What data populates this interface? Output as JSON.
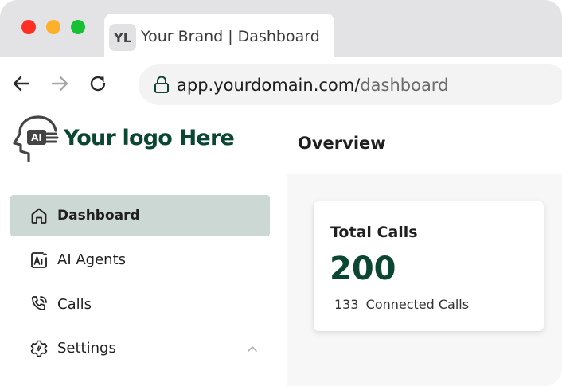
{
  "browser": {
    "window_controls": [
      "close",
      "minimize",
      "zoom"
    ],
    "tab": {
      "favicon_text": "YL",
      "title": "Your Brand | Dashboard"
    },
    "address_bar": {
      "host": "app.yourdomain.com/",
      "path": "dashboard",
      "lock_icon": "lock-icon"
    },
    "nav_icons": [
      "back-arrow-icon",
      "forward-arrow-icon",
      "reload-icon"
    ]
  },
  "sidebar": {
    "logo": {
      "icon_text": "AI",
      "text": "Your logo Here"
    },
    "items": [
      {
        "label": "Dashboard",
        "icon": "home-icon",
        "active": true
      },
      {
        "label": "AI Agents",
        "icon": "ai-agent-icon",
        "active": false
      },
      {
        "label": "Calls",
        "icon": "phone-call-icon",
        "active": false
      },
      {
        "label": "Settings",
        "icon": "gear-icon",
        "active": false,
        "expanded": true
      }
    ]
  },
  "main": {
    "title": "Overview",
    "cards": [
      {
        "title": "Total Calls",
        "value": "200",
        "sub_count": "133",
        "sub_label": "Connected Calls"
      }
    ]
  },
  "colors": {
    "brand": "#0b4633",
    "active_item_bg": "#ccd8d3",
    "traffic_red": "#fe2e25",
    "traffic_yellow": "#fdb02a",
    "traffic_green": "#16c233"
  }
}
